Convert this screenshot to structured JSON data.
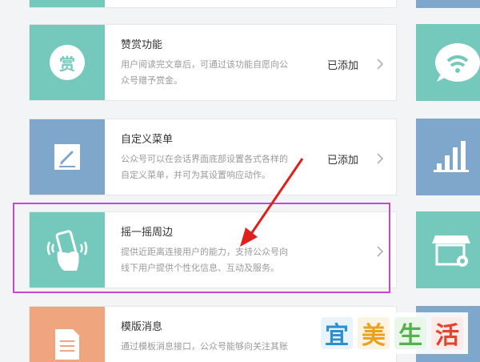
{
  "cards": [
    {
      "title": "赞赏功能",
      "desc_line1": "用户阅读完文章后，可通过该功能自愿向公",
      "desc_line2": "众号赠予赏金。",
      "status": "已添加",
      "icon": "reward-coin-icon",
      "icon_char": "赏",
      "color": "#74c9bc"
    },
    {
      "title": "自定义菜单",
      "desc_line1": "公众号可以在会话界面底部设置各式各样的",
      "desc_line2": "自定义菜单，并可为其设置响应动作。",
      "status": "已添加",
      "icon": "pencil-edit-icon",
      "color": "#7fa7cc"
    },
    {
      "title": "摇一摇周边",
      "desc_line1": "提供近距离连接用户的能力，支持公众号向",
      "desc_line2": "线下用户提供个性化信息、互动及服务。",
      "status": "",
      "icon": "shake-phone-icon",
      "color": "#74c9bc"
    },
    {
      "title": "模版消息",
      "desc_line1": "通过模板消息接口，公众号能够向关注其账",
      "desc_line2": "",
      "status": "",
      "icon": "document-lines-icon",
      "color": "#efa57d"
    }
  ],
  "right_tiles": [
    {
      "icon": "wifi-chat-icon",
      "color": "#74c9bc"
    },
    {
      "icon": "bar-chart-icon",
      "color": "#7fa7cc"
    },
    {
      "icon": "store-settings-icon",
      "color": "#74c9bc"
    },
    {
      "icon": "chevron-up-icon",
      "color": "#7fa7cc"
    }
  ],
  "watermark": {
    "chars": [
      "宜",
      "美",
      "生",
      "活"
    ],
    "colors": [
      "#2d8fd0",
      "#e8a21c",
      "#54b24a",
      "#e3432f"
    ]
  },
  "colors": {
    "highlight": "#cc44d6",
    "arrow": "#e0201c"
  }
}
